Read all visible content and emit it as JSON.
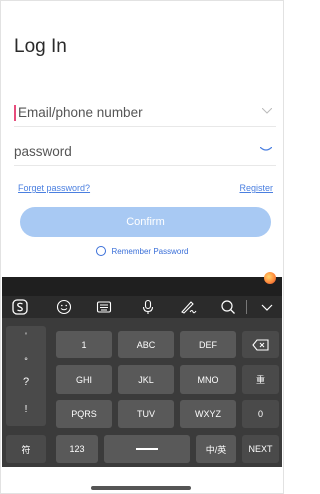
{
  "login": {
    "title": "Log In",
    "email_placeholder": "Email/phone number",
    "password_placeholder": "password",
    "forgot_label": "Forget password?",
    "register_label": "Register",
    "confirm_label": "Confirm",
    "remember_label": "Remember Password"
  },
  "keyboard": {
    "toolbar_icons": [
      "sogou-s-icon",
      "emoji-icon",
      "keyboard-icon",
      "microphone-icon",
      "handwriting-icon",
      "search-icon",
      "collapse-chevron-icon"
    ],
    "side_symbols": [
      "'",
      "°",
      "?",
      "!"
    ],
    "row1": [
      "1",
      "ABC",
      "DEF"
    ],
    "row2": [
      "GHI",
      "JKL",
      "MNO"
    ],
    "row3": [
      "PQRS",
      "TUV",
      "WXYZ"
    ],
    "row4_left": "符",
    "row4_123": "123",
    "row4_lang": "中/英",
    "row4_next": "NEXT",
    "backspace_icon": "backspace-icon",
    "clear_key": "重",
    "zero_key": "0"
  },
  "colors": {
    "accent": "#4a7fe0",
    "confirm_bg": "#a8c9f3",
    "keyboard_bg": "#3b3b3b",
    "key_bg": "#595959"
  }
}
